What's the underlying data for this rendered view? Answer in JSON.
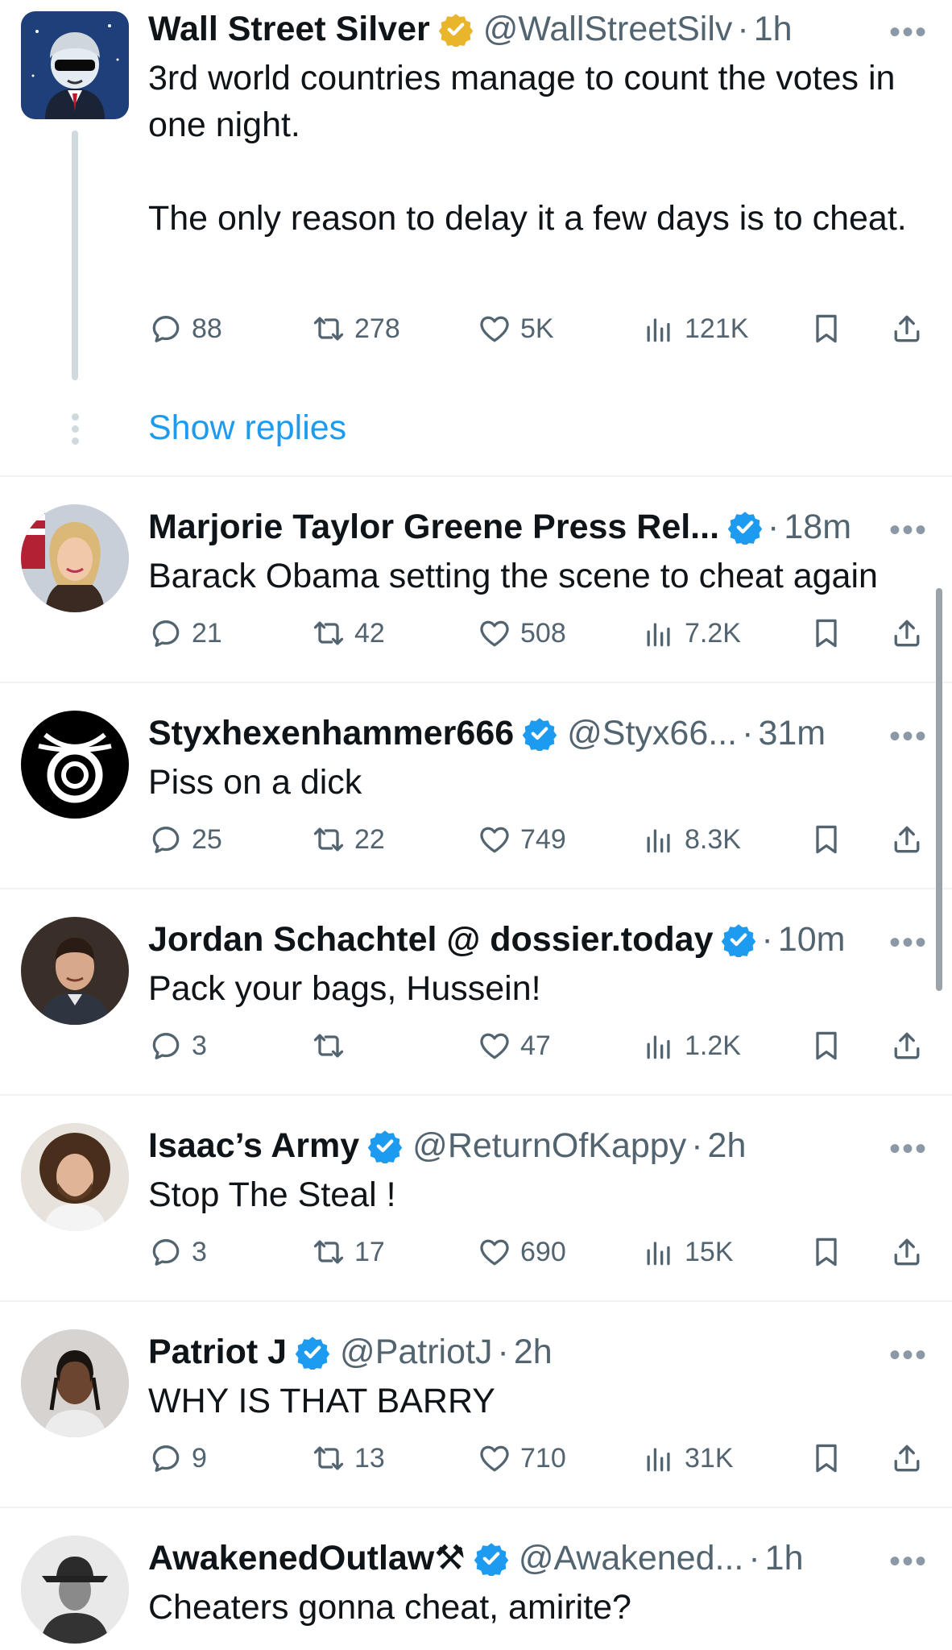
{
  "colors": {
    "accent": "#1d9bf0",
    "gold_badge": "#e9b52b",
    "blue_badge": "#1d9bf0",
    "muted": "#536471"
  },
  "tweets": [
    {
      "name": "Wall Street Silver",
      "badge": "gold",
      "handle": "@WallStreetSilv",
      "time": "1h",
      "text": "3rd world countries manage to count the votes in one night.\n\nThe only reason to delay it a few days is to cheat.",
      "replies": "88",
      "retweets": "278",
      "likes": "5K",
      "views": "121K",
      "show_replies": "Show replies"
    },
    {
      "name": "Marjorie Taylor Greene Press Rel...",
      "badge": "blue",
      "handle": "",
      "time": "18m",
      "text": "Barack Obama setting the scene to cheat again",
      "replies": "21",
      "retweets": "42",
      "likes": "508",
      "views": "7.2K"
    },
    {
      "name": "Styxhexenhammer666",
      "badge": "blue",
      "handle": "@Styx66...",
      "time": "31m",
      "text": "Piss on a dick",
      "replies": "25",
      "retweets": "22",
      "likes": "749",
      "views": "8.3K"
    },
    {
      "name": "Jordan Schachtel @ dossier.today",
      "badge": "blue",
      "handle": "",
      "time": "10m",
      "text": "Pack your bags, Hussein!",
      "replies": "3",
      "retweets": "",
      "likes": "47",
      "views": "1.2K"
    },
    {
      "name": "Isaac’s Army",
      "badge": "blue",
      "handle": "@ReturnOfKappy",
      "time": "2h",
      "text": "Stop The Steal !",
      "replies": "3",
      "retweets": "17",
      "likes": "690",
      "views": "15K"
    },
    {
      "name": "Patriot J",
      "badge": "blue",
      "handle": "@PatriotJ",
      "time": "2h",
      "text": "WHY IS THAT BARRY",
      "replies": "9",
      "retweets": "13",
      "likes": "710",
      "views": "31K"
    },
    {
      "name": "AwakenedOutlaw⚒",
      "badge": "blue",
      "handle": "@Awakened...",
      "time": "1h",
      "text": "Cheaters gonna cheat, amirite?"
    }
  ],
  "icons": {
    "reply": "reply-icon",
    "retweet": "retweet-icon",
    "like": "heart-icon",
    "views": "views-icon",
    "bookmark": "bookmark-icon",
    "share": "share-icon",
    "more": "more-icon"
  },
  "more_glyph": "•••"
}
